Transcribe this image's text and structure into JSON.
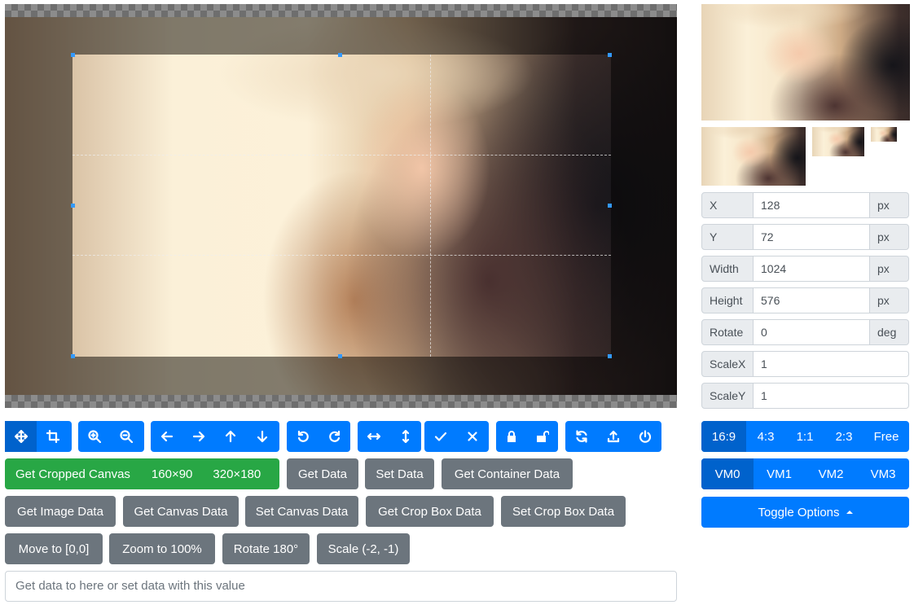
{
  "toolbar_row1": {
    "mode": [
      "move-icon",
      "crop-icon"
    ],
    "zoom": [
      "zoom-in-icon",
      "zoom-out-icon"
    ],
    "move": [
      "arrow-left-icon",
      "arrow-right-icon",
      "arrow-up-icon",
      "arrow-down-icon"
    ],
    "rotate": [
      "rotate-left-icon",
      "rotate-right-icon"
    ],
    "flip": [
      "flip-horizontal-icon",
      "flip-vertical-icon"
    ],
    "crop_actions": [
      "check-icon",
      "times-icon"
    ],
    "lock": [
      "lock-icon",
      "unlock-icon"
    ],
    "misc": [
      "refresh-icon",
      "upload-icon",
      "power-off-icon"
    ]
  },
  "actions": {
    "get_cropped_canvas": "Get Cropped Canvas",
    "size_160": "160×90",
    "size_320": "320×180",
    "get_data": "Get Data",
    "set_data": "Set Data",
    "get_container_data": "Get Container Data",
    "get_image_data": "Get Image Data",
    "get_canvas_data": "Get Canvas Data",
    "set_canvas_data": "Set Canvas Data",
    "get_crop_box_data": "Get Crop Box Data",
    "set_crop_box_data": "Set Crop Box Data",
    "move_to": "Move to [0,0]",
    "zoom_to": "Zoom to 100%",
    "rotate_180": "Rotate 180°",
    "scale": "Scale (-2, -1)"
  },
  "textarea": {
    "placeholder": "Get data to here or set data with this value"
  },
  "data_fields": {
    "x": {
      "label": "X",
      "value": "128",
      "unit": "px"
    },
    "y": {
      "label": "Y",
      "value": "72",
      "unit": "px"
    },
    "width": {
      "label": "Width",
      "value": "1024",
      "unit": "px"
    },
    "height": {
      "label": "Height",
      "value": "576",
      "unit": "px"
    },
    "rotate": {
      "label": "Rotate",
      "value": "0",
      "unit": "deg"
    },
    "scale_x": {
      "label": "ScaleX",
      "value": "1"
    },
    "scale_y": {
      "label": "ScaleY",
      "value": "1"
    }
  },
  "aspect_ratios": {
    "selected": "16:9",
    "options": [
      "16:9",
      "4:3",
      "1:1",
      "2:3",
      "Free"
    ]
  },
  "view_modes": {
    "selected": "VM0",
    "options": [
      "VM0",
      "VM1",
      "VM2",
      "VM3"
    ]
  },
  "toggle_options": "Toggle Options",
  "colors": {
    "primary": "#007bff",
    "primary_active": "#0062cc",
    "secondary": "#6c757d",
    "success": "#28a745",
    "crop_outline": "#3399ff"
  }
}
